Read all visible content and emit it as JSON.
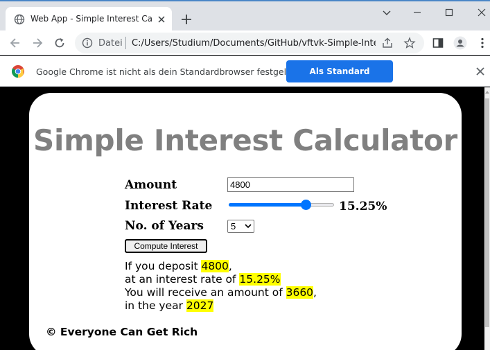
{
  "browser": {
    "tab_title": "Web App - Simple Interest Calculator",
    "address_prefix": "Datei",
    "url": "C:/Users/Studium/Documents/GitHub/vftvk-Simple-Interest-Calculator/index.html",
    "infobar_message": "Google Chrome ist nicht als dein Standardbrowser festgelegt",
    "infobar_button": "Als Standard festlegen"
  },
  "page": {
    "heading": "Simple Interest Calculator",
    "amount_label": "Amount",
    "amount_value": "4800",
    "rate_label": "Interest Rate",
    "rate_display": "15.25%",
    "rate_fraction": 0.7625,
    "years_label": "No. of Years",
    "years_value": "5",
    "compute_button": "Compute Interest",
    "result": {
      "line1_prefix": "If you deposit ",
      "deposit": "4800",
      "line1_suffix": ",",
      "line2_prefix": "at an interest rate of ",
      "rate": "15.25%",
      "line3_prefix": "You will receive an amount of ",
      "amount": "3660",
      "line3_suffix": ",",
      "line4_prefix": "in the year ",
      "year": "2027"
    },
    "footer": "© Everyone Can Get Rich"
  },
  "colors": {
    "accent": "#0075ff",
    "highlight": "#ffff00",
    "heading": "#808080",
    "chrome_blue": "#1a73e8"
  }
}
